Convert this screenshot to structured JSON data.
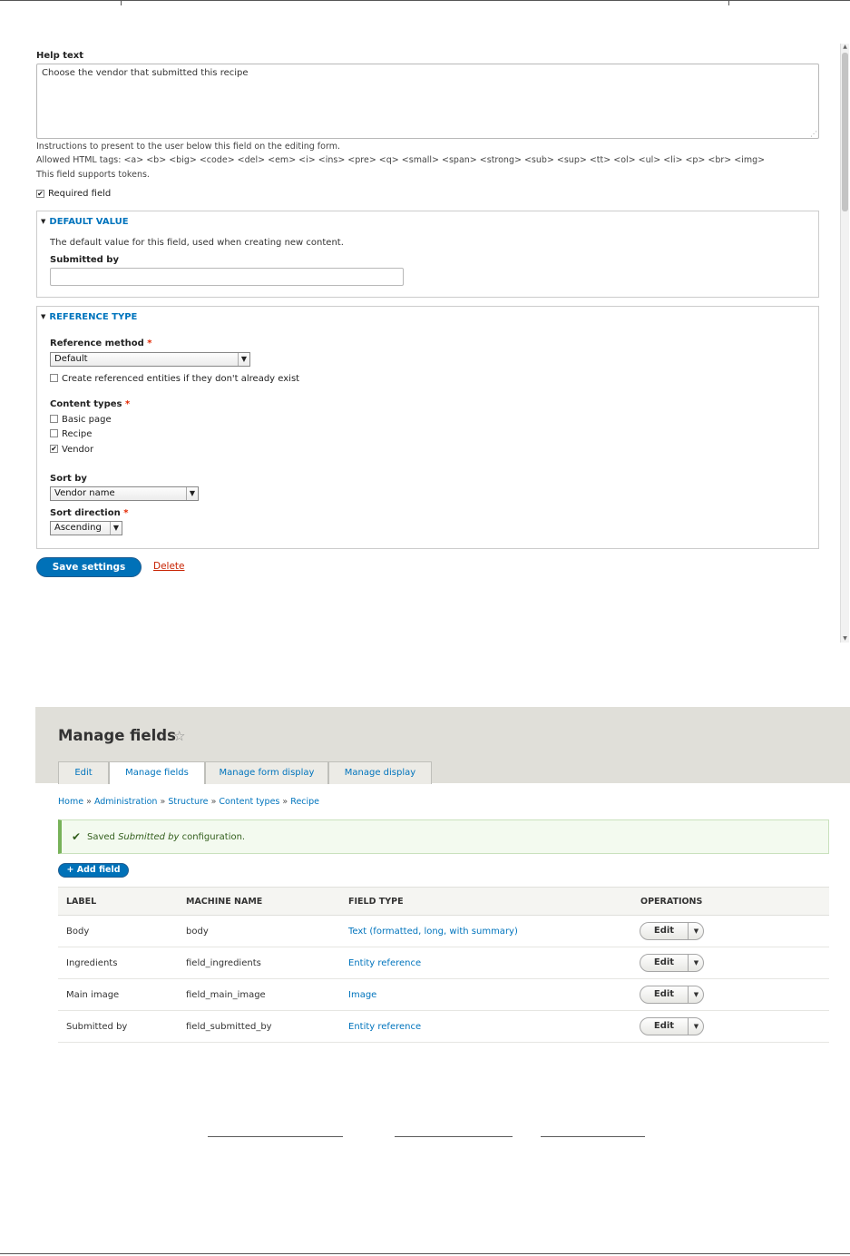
{
  "edit_form": {
    "help_text": {
      "label": "Help text",
      "value": "Choose the vendor that submitted this recipe",
      "description": "Instructions to present to the user below this field on the editing form.",
      "allowed_tags": "Allowed HTML tags: <a> <b> <big> <code> <del> <em> <i> <ins> <pre> <q> <small> <span> <strong> <sub> <sup> <tt> <ol> <ul> <li> <p> <br> <img>",
      "tokens_note": "This field supports tokens."
    },
    "required_field": {
      "label": "Required field",
      "checked": true
    },
    "default_value": {
      "legend": "DEFAULT VALUE",
      "description": "The default value for this field, used when creating new content.",
      "submitted_by_label": "Submitted by",
      "submitted_by_value": ""
    },
    "reference_type": {
      "legend": "REFERENCE TYPE",
      "method_label": "Reference method",
      "method_value": "Default",
      "create_entities_label": "Create referenced entities if they don't already exist",
      "content_types_label": "Content types",
      "content_types": [
        {
          "label": "Basic page",
          "checked": false
        },
        {
          "label": "Recipe",
          "checked": false
        },
        {
          "label": "Vendor",
          "checked": true
        }
      ],
      "sort_by_label": "Sort by",
      "sort_by_value": "Vendor name",
      "sort_direction_label": "Sort direction",
      "sort_direction_value": "Ascending",
      "required_marker": "*"
    },
    "actions": {
      "save_label": "Save settings",
      "delete_label": "Delete"
    }
  },
  "manage_fields": {
    "title": "Manage fields",
    "star_icon": "☆",
    "tabs": [
      {
        "label": "Edit",
        "active": false
      },
      {
        "label": "Manage fields",
        "active": true
      },
      {
        "label": "Manage form display",
        "active": false
      },
      {
        "label": "Manage display",
        "active": false
      }
    ],
    "breadcrumb": [
      "Home",
      "Administration",
      "Structure",
      "Content types",
      "Recipe"
    ],
    "breadcrumb_separator": "»",
    "status": {
      "prefix": "Saved ",
      "field_name": "Submitted by",
      "suffix": " configuration.",
      "color": "#325e1c"
    },
    "add_field_label": "+ Add field",
    "table": {
      "headers": [
        "LABEL",
        "MACHINE NAME",
        "FIELD TYPE",
        "OPERATIONS"
      ],
      "rows": [
        {
          "label": "Body",
          "machine_name": "body",
          "field_type": "Text (formatted, long, with summary)",
          "operation": "Edit"
        },
        {
          "label": "Ingredients",
          "machine_name": "field_ingredients",
          "field_type": "Entity reference",
          "operation": "Edit"
        },
        {
          "label": "Main image",
          "machine_name": "field_main_image",
          "field_type": "Image",
          "operation": "Edit"
        },
        {
          "label": "Submitted by",
          "machine_name": "field_submitted_by",
          "field_type": "Entity reference",
          "operation": "Edit"
        }
      ]
    }
  },
  "colors": {
    "link": "#0074bd",
    "primary_button": "#0071b8",
    "danger": "#c72100",
    "required": "#e32700",
    "header_band": "#e0dfd9"
  }
}
